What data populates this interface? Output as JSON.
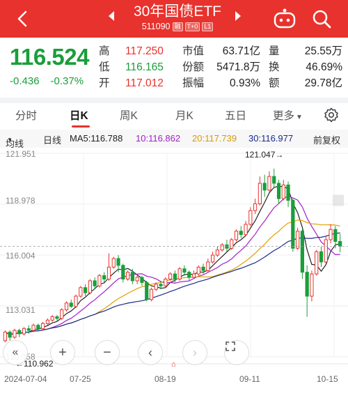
{
  "header": {
    "title": "30年国债ETF",
    "code": "511090",
    "tags": [
      "融",
      "T+0",
      "L1"
    ]
  },
  "quote": {
    "price": "116.524",
    "change": "-0.436",
    "change_pct": "-0.37%",
    "stats": [
      {
        "label": "高",
        "value": "117.250",
        "color": "red"
      },
      {
        "label": "低",
        "value": "116.165",
        "color": "green"
      },
      {
        "label": "开",
        "value": "117.012",
        "color": "red"
      },
      {
        "label": "市值",
        "value": "63.71亿"
      },
      {
        "label": "份额",
        "value": "5471.8万"
      },
      {
        "label": "振幅",
        "value": "0.93%"
      },
      {
        "label": "量",
        "value": "25.55万"
      },
      {
        "label": "换",
        "value": "46.69%"
      },
      {
        "label": "额",
        "value": "29.78亿"
      }
    ]
  },
  "tabs": [
    "分时",
    "日K",
    "周K",
    "月K",
    "五日",
    "更多"
  ],
  "active_tab": "日K",
  "ma_bar": {
    "indicator": "均线",
    "line": "日线",
    "ma5": "MA5:116.788",
    "ma10": "10:116.862",
    "ma20": "20:117.739",
    "ma30": "30:116.977",
    "adjust": "前复权"
  },
  "colors": {
    "up": "#e8322d",
    "down": "#1a9e3a",
    "ma5": "#222222",
    "ma10": "#a020c8",
    "ma20": "#e0a000",
    "ma30": "#1a2a8c"
  },
  "chart_data": {
    "type": "candlestick",
    "y_ticks": [
      "121.951",
      "118.978",
      "116.004",
      "113.031",
      "110.058"
    ],
    "x_ticks": [
      "2024-07-04",
      "07-25",
      "08-19",
      "09-11",
      "10-15"
    ],
    "annotations": {
      "high": "121.047→",
      "low": "←110.962"
    },
    "ylim": [
      110.058,
      121.951
    ],
    "candles": [
      [
        111.0,
        111.5,
        110.9,
        111.6
      ],
      [
        111.5,
        111.2,
        111.0,
        111.6
      ],
      [
        111.2,
        111.6,
        111.1,
        111.7
      ],
      [
        111.6,
        111.4,
        111.2,
        111.7
      ],
      [
        111.4,
        111.7,
        111.3,
        111.8
      ],
      [
        111.7,
        111.6,
        111.4,
        111.9
      ],
      [
        111.6,
        111.9,
        111.5,
        112.0
      ],
      [
        111.9,
        111.7,
        111.6,
        112.0
      ],
      [
        111.7,
        112.0,
        111.6,
        112.1
      ],
      [
        112.0,
        112.2,
        111.9,
        112.3
      ],
      [
        112.2,
        112.4,
        112.1,
        112.5
      ],
      [
        112.4,
        112.3,
        112.1,
        112.5
      ],
      [
        112.3,
        112.8,
        112.2,
        112.9
      ],
      [
        112.8,
        113.2,
        112.7,
        113.3
      ],
      [
        113.2,
        113.0,
        112.9,
        113.4
      ],
      [
        113.0,
        113.6,
        112.9,
        113.7
      ],
      [
        113.6,
        114.1,
        113.5,
        114.2
      ],
      [
        114.1,
        113.8,
        113.6,
        114.3
      ],
      [
        113.8,
        114.5,
        113.7,
        114.6
      ],
      [
        114.5,
        114.2,
        114.0,
        114.7
      ],
      [
        114.2,
        114.8,
        114.1,
        114.9
      ],
      [
        114.8,
        114.6,
        114.4,
        115.0
      ],
      [
        114.6,
        115.3,
        114.5,
        116.1
      ],
      [
        115.3,
        115.8,
        115.2,
        115.9
      ],
      [
        115.8,
        115.4,
        115.0,
        116.0
      ],
      [
        115.4,
        114.6,
        114.4,
        115.5
      ],
      [
        114.6,
        115.0,
        114.5,
        115.1
      ],
      [
        115.0,
        114.5,
        114.3,
        115.2
      ],
      [
        114.5,
        114.7,
        114.3,
        114.9
      ],
      [
        114.7,
        114.4,
        114.2,
        114.8
      ],
      [
        114.4,
        113.4,
        113.3,
        114.5
      ],
      [
        113.4,
        114.0,
        113.3,
        114.1
      ],
      [
        114.0,
        114.3,
        113.9,
        114.4
      ],
      [
        114.3,
        114.2,
        114.0,
        114.5
      ],
      [
        114.2,
        114.6,
        114.1,
        114.7
      ],
      [
        114.6,
        114.9,
        114.5,
        115.0
      ],
      [
        114.9,
        114.6,
        114.4,
        115.1
      ],
      [
        114.6,
        115.2,
        114.5,
        115.3
      ],
      [
        115.2,
        115.0,
        114.8,
        115.4
      ],
      [
        115.0,
        114.7,
        114.5,
        115.1
      ],
      [
        114.7,
        114.9,
        114.6,
        115.1
      ],
      [
        114.9,
        115.3,
        114.8,
        115.4
      ],
      [
        115.3,
        115.1,
        114.9,
        115.5
      ],
      [
        115.1,
        115.6,
        115.0,
        115.8
      ],
      [
        115.6,
        116.0,
        115.5,
        116.2
      ],
      [
        116.0,
        116.3,
        115.9,
        116.5
      ],
      [
        116.3,
        116.6,
        116.2,
        116.7
      ],
      [
        116.6,
        116.4,
        116.2,
        116.9
      ],
      [
        116.4,
        116.9,
        116.3,
        117.0
      ],
      [
        116.9,
        117.4,
        116.8,
        117.5
      ],
      [
        117.4,
        117.2,
        117.0,
        117.7
      ],
      [
        117.2,
        117.8,
        117.1,
        118.0
      ],
      [
        117.8,
        118.6,
        117.7,
        118.8
      ],
      [
        118.6,
        119.0,
        118.4,
        119.3
      ],
      [
        119.0,
        120.2,
        118.9,
        120.6
      ],
      [
        120.2,
        119.8,
        119.4,
        120.7
      ],
      [
        119.8,
        120.6,
        119.7,
        120.9
      ],
      [
        120.6,
        120.2,
        119.9,
        121.05
      ],
      [
        120.2,
        119.3,
        119.0,
        120.4
      ],
      [
        119.3,
        120.1,
        119.2,
        120.4
      ],
      [
        120.1,
        119.2,
        118.8,
        120.3
      ],
      [
        119.2,
        116.4,
        116.2,
        119.3
      ],
      [
        116.4,
        117.4,
        116.3,
        117.6
      ],
      [
        117.4,
        115.0,
        114.6,
        117.5
      ],
      [
        115.0,
        113.6,
        112.4,
        115.4
      ],
      [
        113.6,
        114.9,
        113.3,
        115.1
      ],
      [
        114.9,
        116.2,
        114.8,
        116.3
      ],
      [
        116.2,
        115.6,
        115.3,
        116.5
      ],
      [
        115.6,
        116.9,
        115.5,
        117.1
      ],
      [
        116.9,
        117.5,
        116.7,
        117.8
      ],
      [
        117.5,
        116.8,
        116.4,
        117.7
      ],
      [
        116.8,
        116.52,
        116.165,
        117.25
      ]
    ]
  }
}
